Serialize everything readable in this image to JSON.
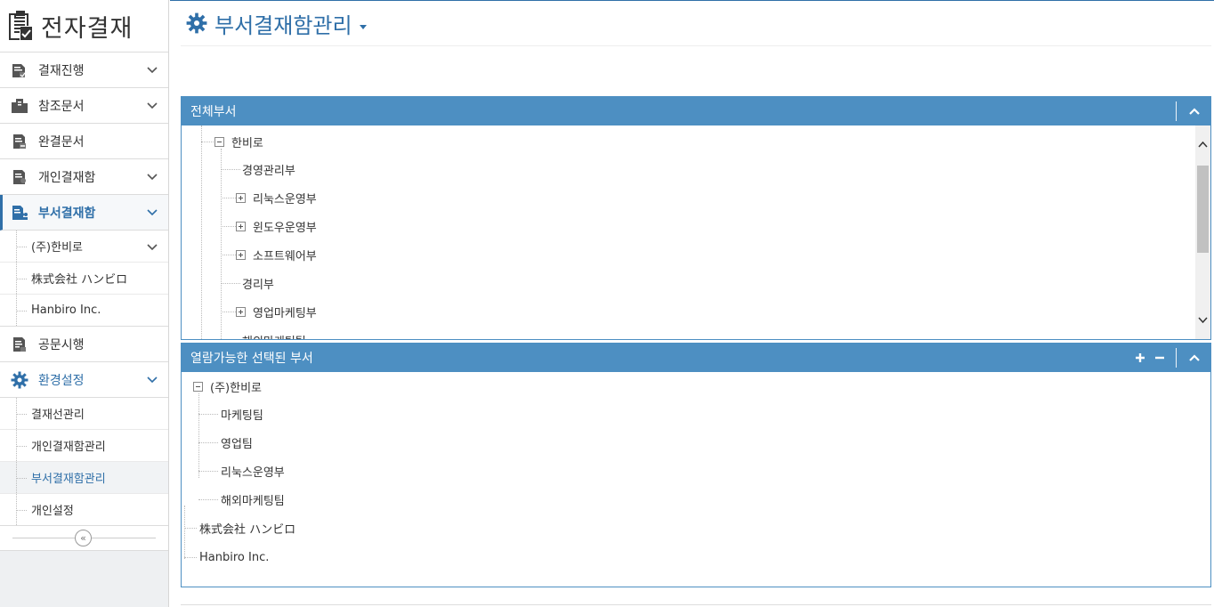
{
  "sidebar": {
    "brand": "전자결재",
    "menu": [
      {
        "label": "결재진행",
        "icon": "document-progress-icon",
        "has_chevron": true
      },
      {
        "label": "참조문서",
        "icon": "reference-document-icon",
        "has_chevron": true
      },
      {
        "label": "완결문서",
        "icon": "completed-document-icon",
        "has_chevron": false
      },
      {
        "label": "개인결재함",
        "icon": "personal-box-icon",
        "has_chevron": true
      },
      {
        "label": "부서결재함",
        "icon": "department-box-icon",
        "has_chevron": true,
        "active": true
      }
    ],
    "dept_sub": [
      "(주)한비로",
      "株式会社 ハンビロ",
      "Hanbiro Inc."
    ],
    "menu2": [
      {
        "label": "공문시행",
        "icon": "official-document-icon"
      },
      {
        "label": "환경설정",
        "icon": "gear-icon"
      }
    ],
    "settings_sub": [
      "결재선관리",
      "개인결재함관리",
      "부서결재함관리",
      "개인설정"
    ]
  },
  "page": {
    "title": "부서결재함관리"
  },
  "panels": {
    "all_depts": {
      "title": "전체부서",
      "tree": [
        "한비로",
        "경영관리부",
        "리눅스운영부",
        "윈도우운영부",
        "소프트웨어부",
        "경리부",
        "영업마케팅부",
        "해외마케팅팀"
      ]
    },
    "selected_depts": {
      "title": "열람가능한 선택된 부서",
      "tree": [
        "(주)한비로",
        "마케팅팀",
        "영업팀",
        "리눅스운영부",
        "해외마케팅팀",
        "株式会社 ハンビロ",
        "Hanbiro Inc."
      ]
    }
  },
  "colors": {
    "accent": "#2f6fa8",
    "panel_header": "#4d8fc2"
  }
}
